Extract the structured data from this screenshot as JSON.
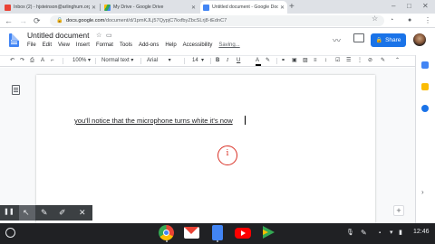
{
  "browser": {
    "tabs": [
      {
        "title": "Inbox (2) - hjsteinson@arlinghum.org",
        "favicon_color": "#ea4335"
      },
      {
        "title": "My Drive - Google Drive",
        "favicon_color": "#34a853"
      },
      {
        "title": "Untitled document - Google Docs",
        "favicon_color": "#4285f4"
      }
    ],
    "new_tab_icon": "+",
    "window_controls": {
      "minimize": "–",
      "maximize": "□",
      "close": "✕"
    },
    "nav": {
      "back": "←",
      "forward": "→",
      "reload": "⟳"
    },
    "url_domain": "docs.google.com",
    "url_path": "/document/d/1pmKJLj57QypjC7kxfbyZbcSLrj8-tEdnC7",
    "star_icon": "☆"
  },
  "docs": {
    "title": "Untitled document",
    "menu": [
      "File",
      "Edit",
      "View",
      "Insert",
      "Format",
      "Tools",
      "Add-ons",
      "Help",
      "Accessibility"
    ],
    "last_edit": "Saving...",
    "share_label": "Share",
    "toolbar": {
      "zoom": "100%",
      "style": "Normal text",
      "font": "Arial",
      "size": "14"
    },
    "body_text": "you'll notice that the microphone turns white it's now",
    "mic_glyph": "i"
  },
  "annotation_toolbar": {
    "pause": "❚❚",
    "arrow": "↖",
    "pen": "✎",
    "highlighter": "✐",
    "close": "✕"
  },
  "shelf": {
    "apps": [
      "Chrome",
      "Gmail",
      "Docs",
      "YouTube",
      "Play Store"
    ],
    "time": "12:46"
  },
  "colors": {
    "accent": "#1a73e8",
    "mic_red": "#d93025",
    "shelf_bg": "#202124"
  }
}
